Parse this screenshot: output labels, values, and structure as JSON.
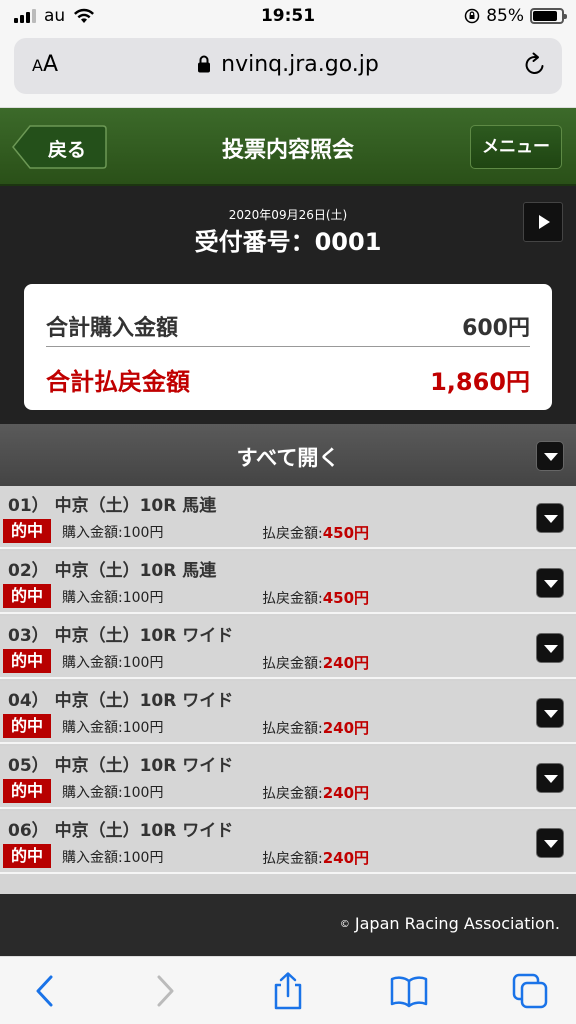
{
  "status_bar": {
    "carrier": "au",
    "time": "19:51",
    "battery": "85%",
    "battery_level": 0.85
  },
  "browser": {
    "aa_label": "AA",
    "url": "nvinq.jra.go.jp"
  },
  "header": {
    "back_label": "戻る",
    "title": "投票内容照会",
    "menu_label": "メニュー"
  },
  "receipt": {
    "date": "2020年09月26日(土)",
    "number": "受付番号：0001"
  },
  "totals": {
    "purchase_label": "合計購入金額",
    "purchase_value": "600円",
    "refund_label": "合計払戻金額",
    "refund_value": "1,860円"
  },
  "open_all_label": "すべて開く",
  "bets": [
    {
      "title": "01）  中京（土）10R  馬連",
      "badge": "的中",
      "buy": "購入金額:100円",
      "refund_label": "払戻金額:",
      "refund_value": "450円"
    },
    {
      "title": "02）  中京（土）10R  馬連",
      "badge": "的中",
      "buy": "購入金額:100円",
      "refund_label": "払戻金額:",
      "refund_value": "450円"
    },
    {
      "title": "03）  中京（土）10R  ワイド",
      "badge": "的中",
      "buy": "購入金額:100円",
      "refund_label": "払戻金額:",
      "refund_value": "240円"
    },
    {
      "title": "04）  中京（土）10R  ワイド",
      "badge": "的中",
      "buy": "購入金額:100円",
      "refund_label": "払戻金額:",
      "refund_value": "240円"
    },
    {
      "title": "05）  中京（土）10R  ワイド",
      "badge": "的中",
      "buy": "購入金額:100円",
      "refund_label": "払戻金額:",
      "refund_value": "240円"
    },
    {
      "title": "06）  中京（土）10R  ワイド",
      "badge": "的中",
      "buy": "購入金額:100円",
      "refund_label": "払戻金額:",
      "refund_value": "240円"
    }
  ],
  "footer": {
    "copyright_symbol": "©",
    "copyright": "Japan Racing Association."
  },
  "colors": {
    "header_green": "#2a5018",
    "refund_red": "#c00000",
    "badge_red": "#b80000",
    "ios_blue": "#1a73e8"
  }
}
